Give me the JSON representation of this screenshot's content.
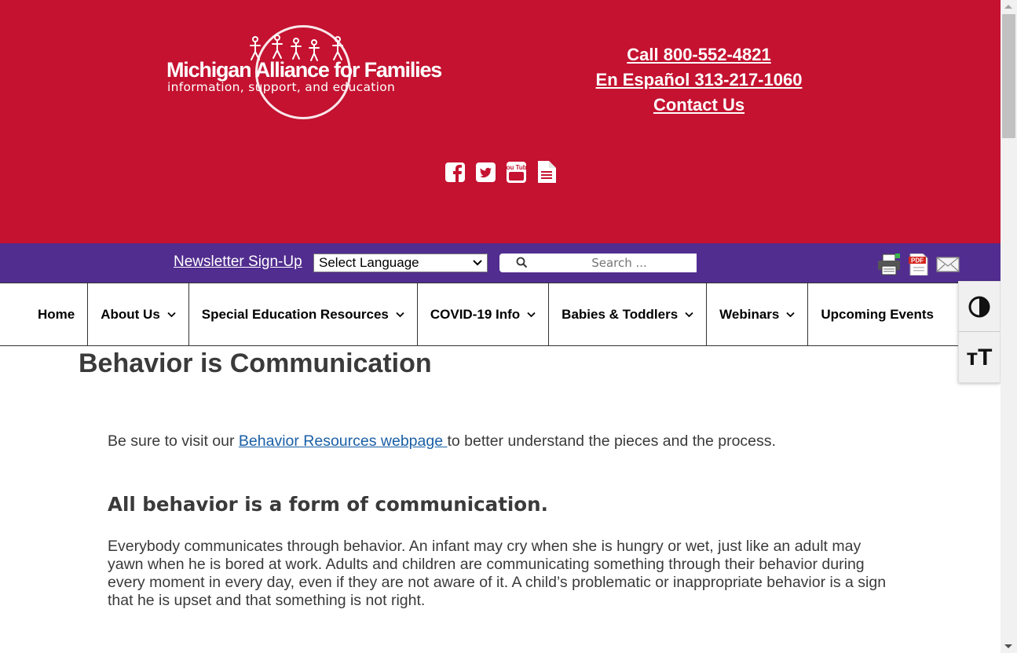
{
  "header": {
    "logo": {
      "title": "Michigan Alliance for Families",
      "subtitle": "information, support, and education"
    },
    "contact_links": [
      "Call 800-552-4821",
      "En Español 313-217-1060",
      "Contact Us"
    ],
    "social_icons": [
      "facebook-icon",
      "twitter-icon",
      "youtube-icon",
      "document-icon"
    ],
    "youtube_glyph_text": "You Tube"
  },
  "toolbar": {
    "newsletter": "Newsletter Sign-Up",
    "language_select": "Select Language",
    "search_placeholder": "Search ...",
    "tool_icons": [
      "print-icon",
      "pdf-icon",
      "email-icon"
    ],
    "pdf_glyph_text": "PDF"
  },
  "nav": {
    "items": [
      {
        "label": "Home",
        "dropdown": false
      },
      {
        "label": "About Us",
        "dropdown": true
      },
      {
        "label": "Special Education Resources",
        "dropdown": true
      },
      {
        "label": "COVID-19 Info",
        "dropdown": true
      },
      {
        "label": "Babies & Toddlers",
        "dropdown": true
      },
      {
        "label": "Webinars",
        "dropdown": true
      },
      {
        "label": "Upcoming Events",
        "dropdown": false
      }
    ]
  },
  "accessibility": {
    "contrast_icon": "contrast-icon",
    "text_size_glyph": "ᴛT"
  },
  "content": {
    "title": "Behavior is Communication",
    "intro_before": "Be sure to visit our ",
    "intro_link": "Behavior Resources webpage ",
    "intro_after": "to better understand the pieces and the process.",
    "heading": "All behavior is a form of communication.",
    "paragraph": "Everybody communicates through behavior. An infant may cry when she is hungry or wet, just like an adult may yawn when he is bored at work. Adults and children are communicating something through their behavior during every moment in every day, even if they are not aware of it. A child’s problematic or inappropriate behavior is a sign that he is upset and that something is not right."
  },
  "colors": {
    "header_red": "#c41230",
    "toolbar_purple": "#512d8f",
    "link_blue": "#1a5fa6"
  }
}
